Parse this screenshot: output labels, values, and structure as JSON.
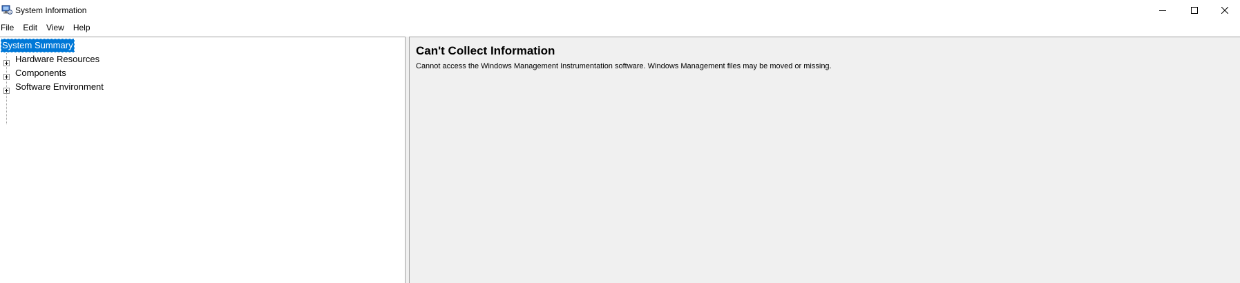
{
  "window": {
    "title": "System Information",
    "app_icon": "system-information-icon",
    "controls": {
      "minimize_icon": "minimize-icon",
      "maximize_icon": "maximize-icon",
      "close_icon": "close-icon"
    }
  },
  "menubar": {
    "items": [
      {
        "label": "File"
      },
      {
        "label": "Edit"
      },
      {
        "label": "View"
      },
      {
        "label": "Help"
      }
    ]
  },
  "tree": {
    "items": [
      {
        "label": "System Summary",
        "selected": true,
        "expandable": false
      },
      {
        "label": "Hardware Resources",
        "selected": false,
        "expandable": true
      },
      {
        "label": "Components",
        "selected": false,
        "expandable": true
      },
      {
        "label": "Software Environment",
        "selected": false,
        "expandable": true
      }
    ]
  },
  "content": {
    "title": "Can't Collect Information",
    "message": "Cannot access the Windows Management Instrumentation software. Windows Management files may be moved or missing."
  },
  "colors": {
    "selection": "#0078d7",
    "content_background": "#f0f0f0",
    "border": "#a0a0a0"
  }
}
